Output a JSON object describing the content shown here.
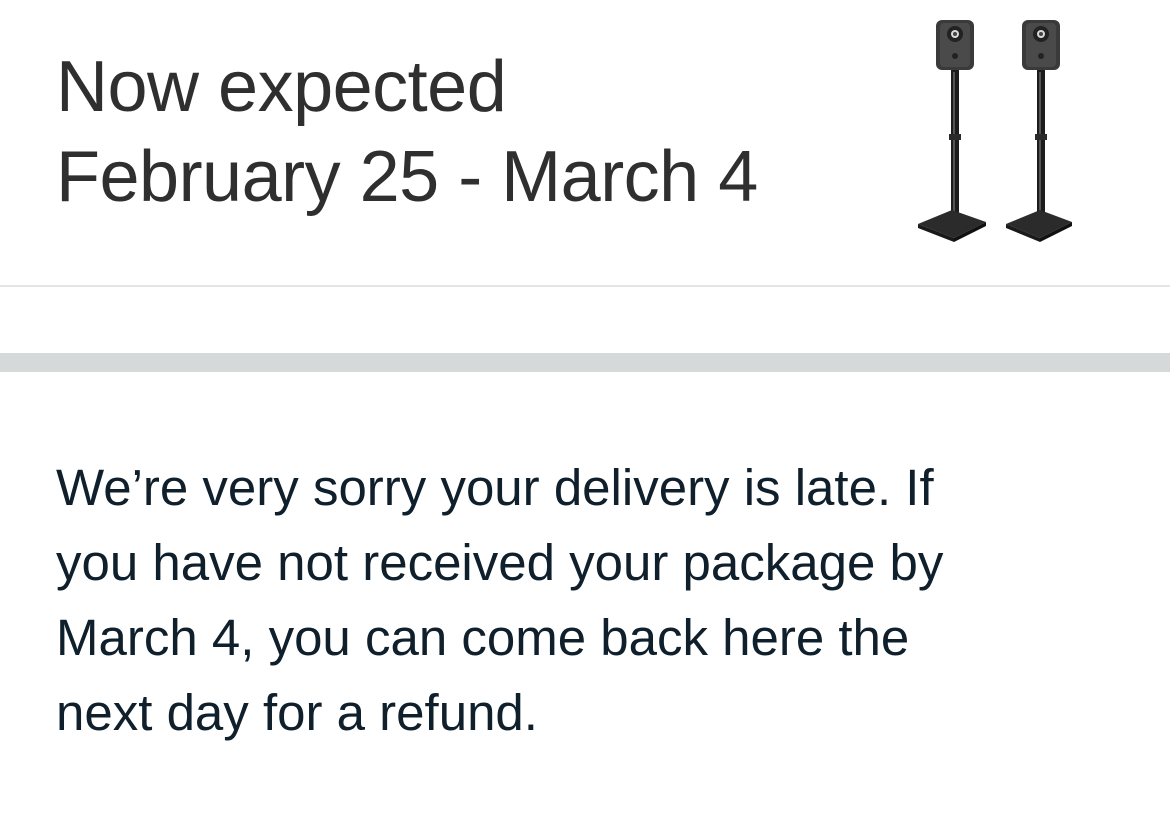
{
  "delivery": {
    "status_line_1": "Now expected",
    "status_line_2": "February 25 - March 4",
    "product_image": "speaker-stands-product-image"
  },
  "message": {
    "lines": [
      "We’re very sorry your delivery is late. If",
      "you have not received your package by",
      "March 4, you can come back here the",
      "next day for a refund."
    ]
  },
  "colors": {
    "title_text": "#2f2f2f",
    "message_text": "#0f1f2b",
    "divider": "#d5d9d9",
    "hairline": "#e3e6e6",
    "background": "#ffffff"
  }
}
